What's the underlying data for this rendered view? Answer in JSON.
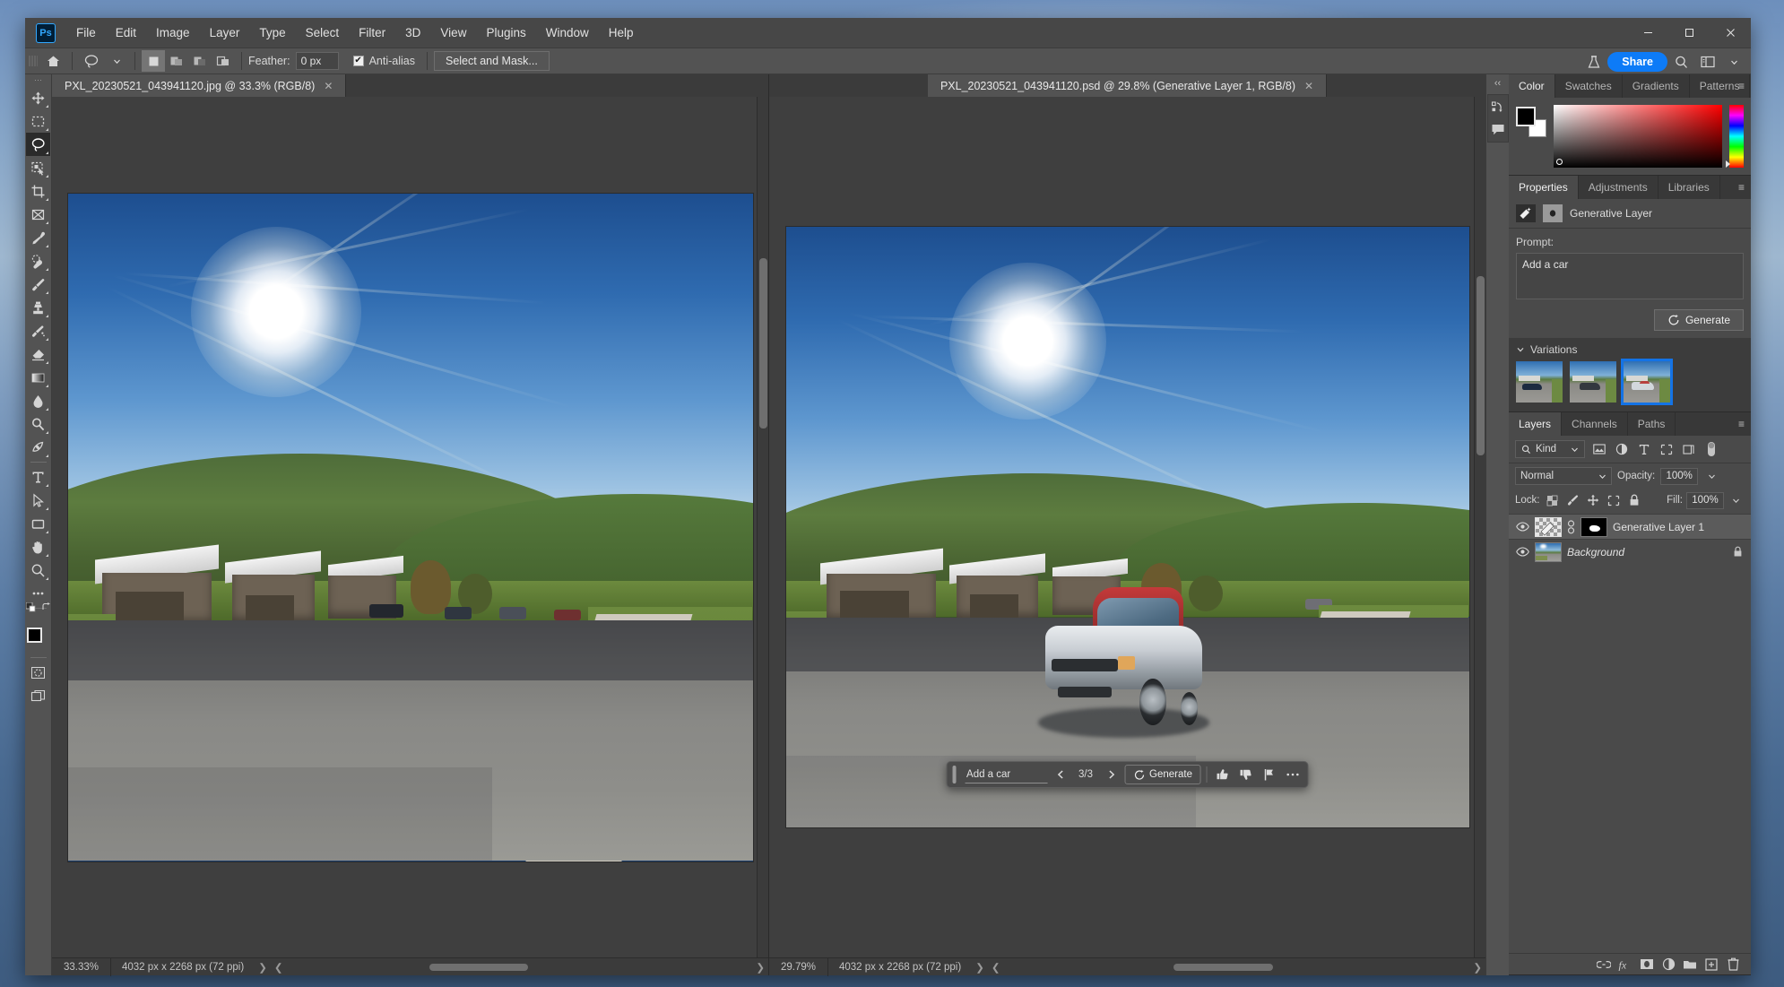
{
  "app": {
    "logo": "Ps",
    "menus": [
      "File",
      "Edit",
      "Image",
      "Layer",
      "Type",
      "Select",
      "Filter",
      "3D",
      "View",
      "Plugins",
      "Window",
      "Help"
    ],
    "window_controls": {
      "minimize": "minimize-icon",
      "maximize": "maximize-icon",
      "close": "close-icon"
    }
  },
  "options_bar": {
    "home_icon": "home-icon",
    "tool_preset": "lasso-tool-preset",
    "selection_modes": [
      "new-selection",
      "add-to-selection",
      "subtract-from-selection",
      "intersect-selection"
    ],
    "feather_label": "Feather:",
    "feather_value": "0 px",
    "antialias_label": "Anti-alias",
    "antialias_checked": true,
    "select_and_mask": "Select and Mask...",
    "flask_icon": "beta-flask-icon",
    "share_label": "Share",
    "search_icon": "search-icon",
    "workspace_icon": "workspace-icon",
    "chevron": "chevron-down-icon"
  },
  "toolbar": {
    "tools": [
      {
        "name": "move-tool",
        "icon": "move-icon",
        "active": false
      },
      {
        "name": "rectangular-marquee-tool",
        "icon": "marquee-icon",
        "active": false
      },
      {
        "name": "lasso-tool",
        "icon": "lasso-icon",
        "active": true
      },
      {
        "name": "object-selection-tool",
        "icon": "object-select-icon",
        "active": false
      },
      {
        "name": "crop-tool",
        "icon": "crop-icon",
        "active": false
      },
      {
        "name": "frame-tool",
        "icon": "frame-icon",
        "active": false
      },
      {
        "name": "eyedropper-tool",
        "icon": "eyedropper-icon",
        "active": false
      },
      {
        "name": "spot-healing-brush-tool",
        "icon": "healing-icon",
        "active": false
      },
      {
        "name": "brush-tool",
        "icon": "brush-icon",
        "active": false
      },
      {
        "name": "clone-stamp-tool",
        "icon": "stamp-icon",
        "active": false
      },
      {
        "name": "history-brush-tool",
        "icon": "history-brush-icon",
        "active": false
      },
      {
        "name": "eraser-tool",
        "icon": "eraser-icon",
        "active": false
      },
      {
        "name": "gradient-tool",
        "icon": "gradient-icon",
        "active": false
      },
      {
        "name": "blur-tool",
        "icon": "blur-drop-icon",
        "active": false
      },
      {
        "name": "dodge-tool",
        "icon": "dodge-icon",
        "active": false
      },
      {
        "name": "pen-tool",
        "icon": "pen-icon",
        "active": false
      },
      {
        "name": "type-tool",
        "icon": "type-icon",
        "active": false
      },
      {
        "name": "path-selection-tool",
        "icon": "path-arrow-icon",
        "active": false
      },
      {
        "name": "rectangle-tool",
        "icon": "rectangle-icon",
        "active": false
      },
      {
        "name": "hand-tool",
        "icon": "hand-icon",
        "active": false
      },
      {
        "name": "zoom-tool",
        "icon": "zoom-icon",
        "active": false
      },
      {
        "name": "edit-toolbar",
        "icon": "ellipsis-icon",
        "active": false
      }
    ],
    "default_colors_icon": "default-colors-icon",
    "swap_colors_icon": "swap-colors-icon",
    "foreground_color": "#000000",
    "background_color": "#ffffff",
    "quick_mask_icon": "quick-mask-icon",
    "screen_mode_icon": "screen-mode-icon"
  },
  "documents": [
    {
      "tab_title": "PXL_20230521_043941120.jpg @ 33.3% (RGB/8)",
      "active": false,
      "zoom": "33.33%",
      "dimensions": "4032 px x 2268 px (72 ppi)",
      "has_car": false
    },
    {
      "tab_title": "PXL_20230521_043941120.psd @ 29.8% (Generative Layer 1, RGB/8)",
      "active": true,
      "zoom": "29.79%",
      "dimensions": "4032 px x 2268 px (72 ppi)",
      "has_car": true
    }
  ],
  "contextual_taskbar": {
    "prompt_value": "Add a car",
    "prev_icon": "chevron-left-icon",
    "variation_count": "3/3",
    "next_icon": "chevron-right-icon",
    "generate_icon": "generate-sparkle-icon",
    "generate_label": "Generate",
    "thumbs_up_icon": "thumbs-up-icon",
    "thumbs_down_icon": "thumbs-down-icon",
    "report_icon": "flag-icon",
    "more_icon": "ellipsis-icon",
    "handle_icon": "drag-handle-icon"
  },
  "rail": {
    "collapse_icon": "collapse-panels-icon",
    "icons": [
      "history-icon",
      "comments-icon"
    ]
  },
  "color_panel": {
    "tabs": [
      {
        "label": "Color",
        "active": true
      },
      {
        "label": "Swatches",
        "active": false
      },
      {
        "label": "Gradients",
        "active": false
      },
      {
        "label": "Patterns",
        "active": false
      }
    ],
    "menu_icon": "panel-menu-icon",
    "foreground": "#000000",
    "background": "#ffffff",
    "picked_hue": "#ff0000"
  },
  "properties_panel": {
    "tabs": [
      {
        "label": "Properties",
        "active": true
      },
      {
        "label": "Adjustments",
        "active": false
      },
      {
        "label": "Libraries",
        "active": false
      }
    ],
    "menu_icon": "panel-menu-icon",
    "header_icon": "generative-layer-icon",
    "mask_icon": "layer-mask-icon",
    "header_label": "Generative Layer",
    "prompt_label": "Prompt:",
    "prompt_value": "Add a car",
    "generate_icon": "generate-sparkle-icon",
    "generate_label": "Generate",
    "variations_label": "Variations",
    "variations_chevron": "chevron-down-icon",
    "variations": [
      {
        "name": "variation-1",
        "selected": false,
        "car_color": "#2c3f5c"
      },
      {
        "name": "variation-2",
        "selected": false,
        "car_color": "#3a3f45"
      },
      {
        "name": "variation-3",
        "selected": true,
        "car_color": "#d8dde2"
      }
    ],
    "selection_color": "#1473e6"
  },
  "layers_panel": {
    "tabs": [
      {
        "label": "Layers",
        "active": true
      },
      {
        "label": "Channels",
        "active": false
      },
      {
        "label": "Paths",
        "active": false
      }
    ],
    "menu_icon": "panel-menu-icon",
    "filter_label": "Kind",
    "filter_search_icon": "search-icon",
    "filter_icons": [
      "filter-pixel-icon",
      "filter-adjustment-icon",
      "filter-type-icon",
      "filter-shape-icon",
      "filter-smart-object-icon"
    ],
    "filter_toggle_icon": "filter-toggle-icon",
    "blend_mode": "Normal",
    "opacity_label": "Opacity:",
    "opacity_value": "100%",
    "lock_label": "Lock:",
    "lock_icons": [
      "lock-transparency-icon",
      "lock-image-icon",
      "lock-position-icon",
      "lock-artboard-icon",
      "lock-all-icon"
    ],
    "fill_label": "Fill:",
    "fill_value": "100%",
    "layers": [
      {
        "name": "Generative Layer 1",
        "visible": true,
        "selected": true,
        "italic": false,
        "locked": false,
        "has_mask": true,
        "thumb_type": "generative",
        "link_icon": "link-icon"
      },
      {
        "name": "Background",
        "visible": true,
        "selected": false,
        "italic": true,
        "locked": true,
        "has_mask": false,
        "thumb_type": "photo",
        "lock_icon": "lock-icon"
      }
    ],
    "footer_icons": [
      "link-layers-icon",
      "layer-style-fx-icon",
      "add-mask-icon",
      "adjustment-layer-icon",
      "new-group-icon",
      "new-layer-icon",
      "delete-layer-icon"
    ]
  }
}
